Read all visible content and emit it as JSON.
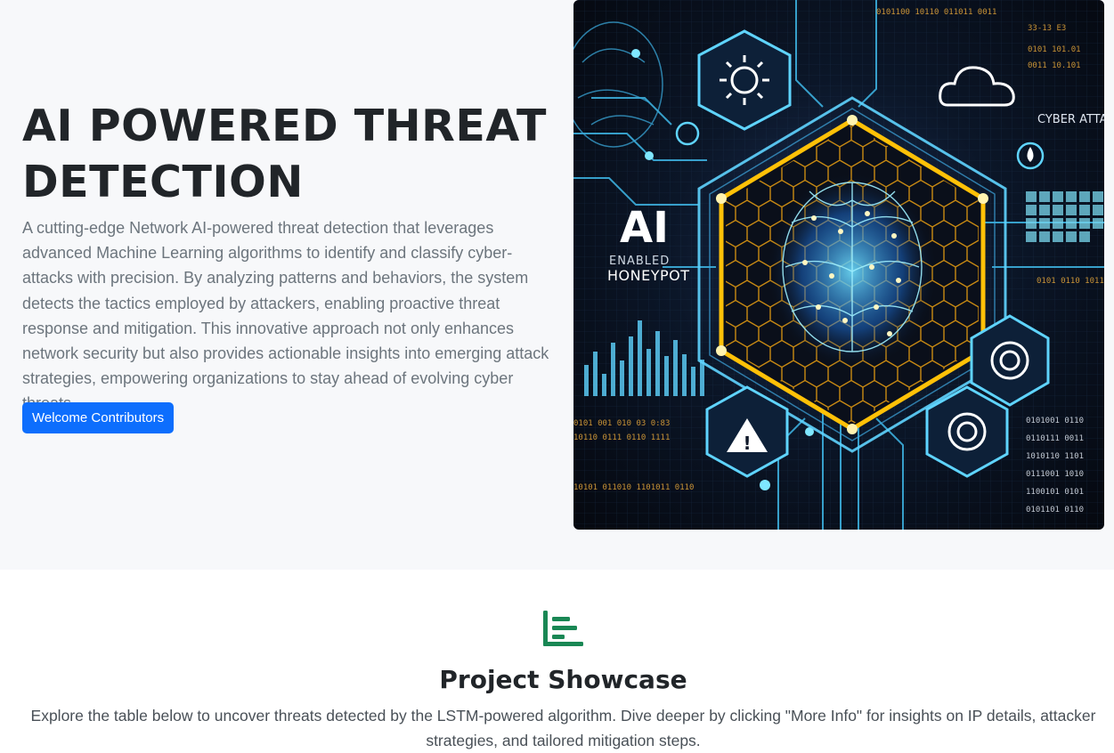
{
  "hero": {
    "title": "AI POWERED THREAT DETECTION",
    "description": "A cutting-edge Network AI-powered threat detection that leverages advanced Machine Learning algorithms to identify and classify cyber-attacks with precision. By analyzing patterns and behaviors, the system detects the tactics employed by attackers, enabling proactive threat response and mitigation. This innovative approach not only enhances network security but also provides actionable insights into emerging attack strategies, empowering organizations to stay ahead of evolving cyber threats",
    "button_label": "Welcome Contributors",
    "image": {
      "ai_text": "AI",
      "subtitle_line1": "ENABLED",
      "subtitle_line2": "HONEYPOT",
      "cyber_text": "CYBER ATTA"
    }
  },
  "showcase": {
    "icon": "bar-chart-steps-icon",
    "title": "Project Showcase",
    "description": "Explore the table below to uncover threats detected by the LSTM-powered algorithm. Dive deeper by clicking \"More Info\" for insights on IP details, attacker strategies, and tailored mitigation steps."
  },
  "colors": {
    "primary": "#0d6efd",
    "hero_bg": "#f7f8fa",
    "accent_green": "#198754",
    "glow_gold": "#ffc107",
    "glow_cyan": "#5fd4ff"
  }
}
